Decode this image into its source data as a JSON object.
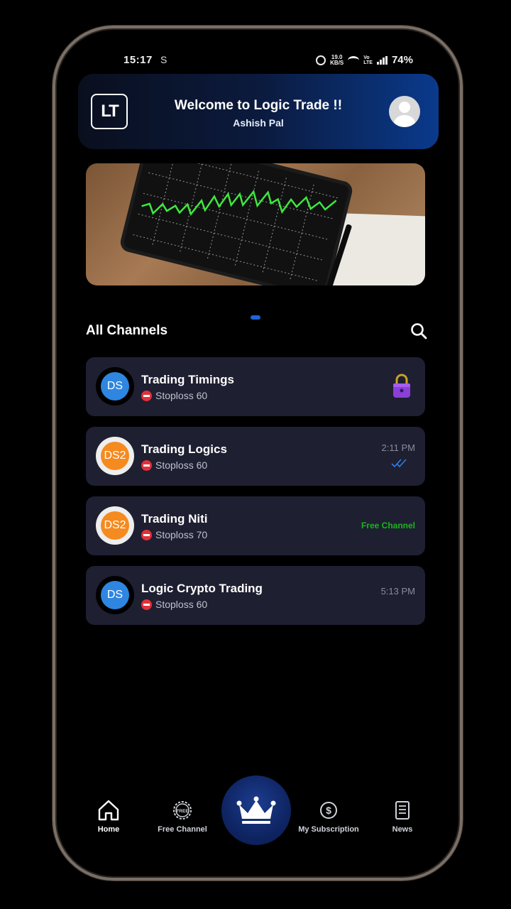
{
  "status_bar": {
    "time": "15:17",
    "s_icon": "S",
    "speed": "19.0\nKB/S",
    "volte": "Vo\nLTE",
    "battery": "74%"
  },
  "header": {
    "logo_text": "LT",
    "title": "Welcome to Logic Trade !!",
    "user_name": "Ashish Pal"
  },
  "section": {
    "title": "All Channels"
  },
  "channels": [
    {
      "initials": "DS",
      "avatar_color": "#2e86e0",
      "name": "Trading Timings",
      "subtitle": "Stoploss 60",
      "trailing": "lock-icon"
    },
    {
      "initials": "DS2",
      "avatar_color": "#f58a1f",
      "name": "Trading Logics",
      "subtitle": "Stoploss 60",
      "time": "2:11 PM",
      "trailing": "double-check-icon"
    },
    {
      "initials": "DS2",
      "avatar_color": "#f58a1f",
      "name": "Trading Niti",
      "subtitle": "Stoploss 70",
      "tag": "Free Channel"
    },
    {
      "initials": "DS",
      "avatar_color": "#2e86e0",
      "name": "Logic Crypto Trading",
      "subtitle": "Stoploss 60",
      "time": "5:13 PM"
    }
  ],
  "nav": {
    "home": "Home",
    "free_channel": "Free Channel",
    "free_badge": "FREE",
    "my_subscription": "My Subscription",
    "news": "News"
  },
  "colors": {
    "accent": "#1f64d6",
    "card_bg": "#1e1f31",
    "free_green": "#19b619"
  }
}
